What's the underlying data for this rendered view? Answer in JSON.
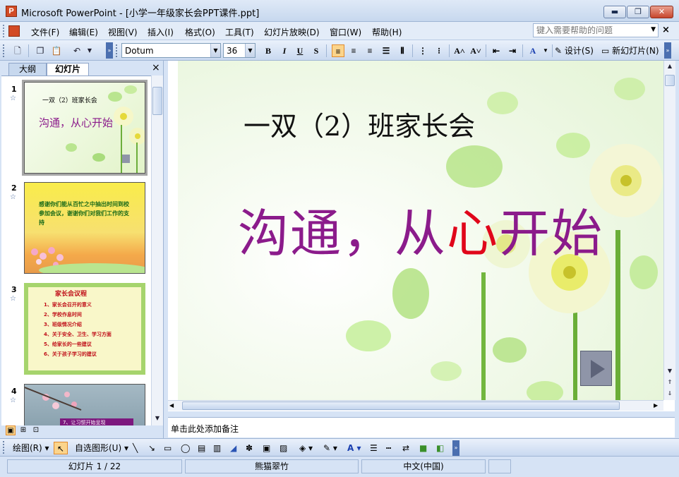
{
  "window": {
    "title": "Microsoft PowerPoint - [小学一年级家长会PPT课件.ppt]",
    "app_icon": "powerpoint-icon",
    "min_label": "▬",
    "max_label": "❐",
    "close_label": "✕"
  },
  "menu": {
    "items": [
      "文件(F)",
      "编辑(E)",
      "视图(V)",
      "插入(I)",
      "格式(O)",
      "工具(T)",
      "幻灯片放映(D)",
      "窗口(W)",
      "帮助(H)"
    ],
    "help_placeholder": "键入需要帮助的问题",
    "close_doc": "×"
  },
  "toolbar": {
    "font_name": "Dotum",
    "font_size": "36",
    "bold": "B",
    "italic": "I",
    "underline": "U",
    "shadow": "S",
    "design_label": "设计(S)",
    "new_slide_label": "新幻灯片(N)"
  },
  "left_panel": {
    "tab_outline": "大纲",
    "tab_slides": "幻灯片",
    "close": "×",
    "thumbnails": [
      {
        "num": "1",
        "title": "一双（2）班家长会",
        "subtitle": "沟通，从心开始"
      },
      {
        "num": "2",
        "text": "感谢你们能从百忙之中抽出时间到校参加会议，谢谢你们对我们工作的支持"
      },
      {
        "num": "3",
        "heading": "家长会议程",
        "items": [
          "1、家长会召开的意义",
          "2、学校作息时间",
          "3、班级情况介绍",
          "4、关于安全、卫生、学习方面",
          "5、给家长的一些建议",
          "6、关于孩子学习的建议"
        ]
      },
      {
        "num": "4",
        "caption": "7、让习惯开始呈现"
      }
    ]
  },
  "slide": {
    "title": "一双（2）班家长会",
    "subtitle_part1": "沟通，从",
    "subtitle_heart": "心",
    "subtitle_part2": "开始"
  },
  "notes": {
    "placeholder": "单击此处添加备注"
  },
  "draw_toolbar": {
    "draw_label": "绘图(R)",
    "autoshapes_label": "自选图形(U)"
  },
  "status": {
    "slide_info": "幻灯片 1 / 22",
    "design_name": "熊猫翠竹",
    "language": "中文(中国)"
  },
  "colors": {
    "accent": "#d24b26",
    "subtitle": "#8b1b8b",
    "heart": "#e0061a"
  }
}
